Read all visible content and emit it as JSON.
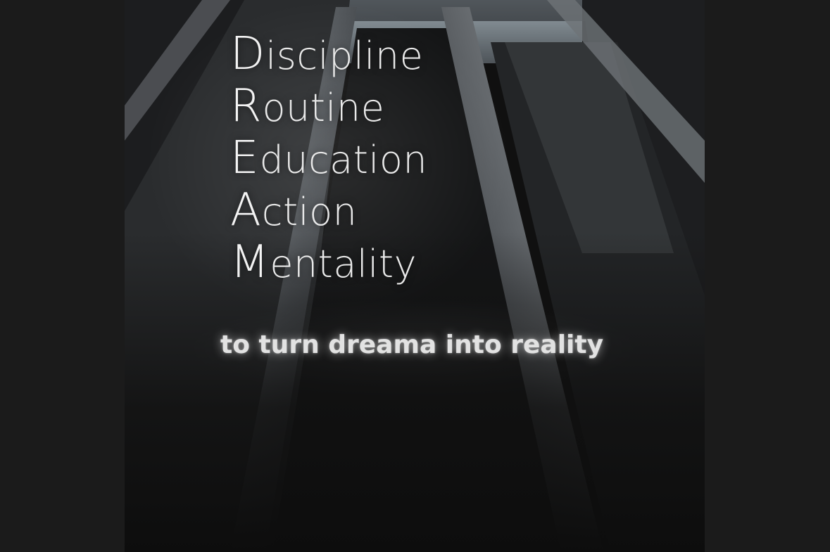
{
  "acronym": {
    "items": [
      {
        "initial": "D",
        "rest": "iscipline"
      },
      {
        "initial": "R",
        "rest": "outine"
      },
      {
        "initial": "E",
        "rest": "ducation"
      },
      {
        "initial": "A",
        "rest": "ction"
      },
      {
        "initial": "M",
        "rest": "entality"
      }
    ]
  },
  "tagline": "to turn dreama into reality",
  "colors": {
    "background": "#1b1b1b",
    "photo_dark": "#101010",
    "text": "#e9e9e9"
  }
}
